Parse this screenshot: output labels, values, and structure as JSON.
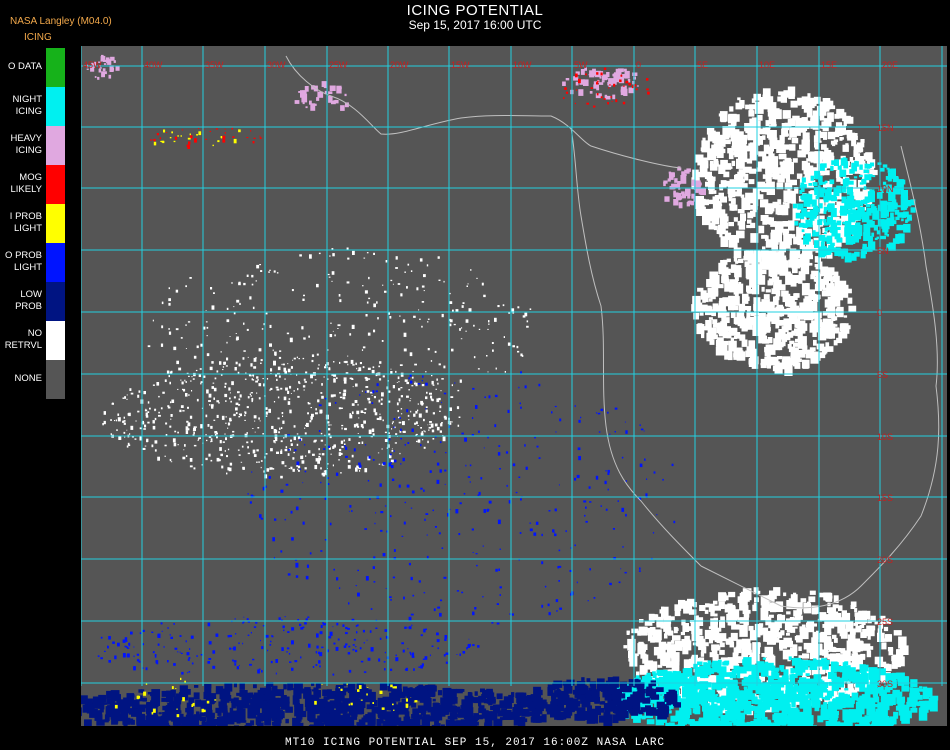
{
  "header": {
    "title": "ICING POTENTIAL",
    "subtitle": "Sep 15, 2017 16:00 UTC",
    "org": "NASA Langley (M04.0)",
    "product": "ICING"
  },
  "legend": [
    {
      "label": "O DATA",
      "color": "#16b21a"
    },
    {
      "label": "NIGHT\nICING",
      "color": "#00f0f0"
    },
    {
      "label": "HEAVY\nICING",
      "color": "#e0a8e0"
    },
    {
      "label": "MOG\nLIKELY",
      "color": "#ff0000"
    },
    {
      "label": "I PROB\nLIGHT",
      "color": "#ffff00"
    },
    {
      "label": "O PROB\nLIGHT",
      "color": "#0014ff"
    },
    {
      "label": "LOW\nPROB",
      "color": "#001482"
    },
    {
      "label": "NO\nRETRVL",
      "color": "#ffffff"
    },
    {
      "label": "NONE",
      "color": "#555555"
    }
  ],
  "map": {
    "background": "#555555",
    "grid_color": "#22d0e0",
    "lat_lon_label_color": "#c81e1e",
    "top_labels": [
      "45W",
      "40W",
      "35W",
      "30W",
      "25W",
      "20W",
      "15W",
      "10W",
      "5W",
      "0",
      "5E",
      "10E",
      "15E",
      "20E"
    ],
    "right_labels": [
      "15N",
      "10N",
      "5N",
      "0",
      "5S",
      "10S",
      "15S",
      "20S",
      "25S",
      "30S"
    ]
  },
  "footer": "MT10  ICING POTENTIAL    SEP 15, 2017 16:00Z   NASA LARC"
}
